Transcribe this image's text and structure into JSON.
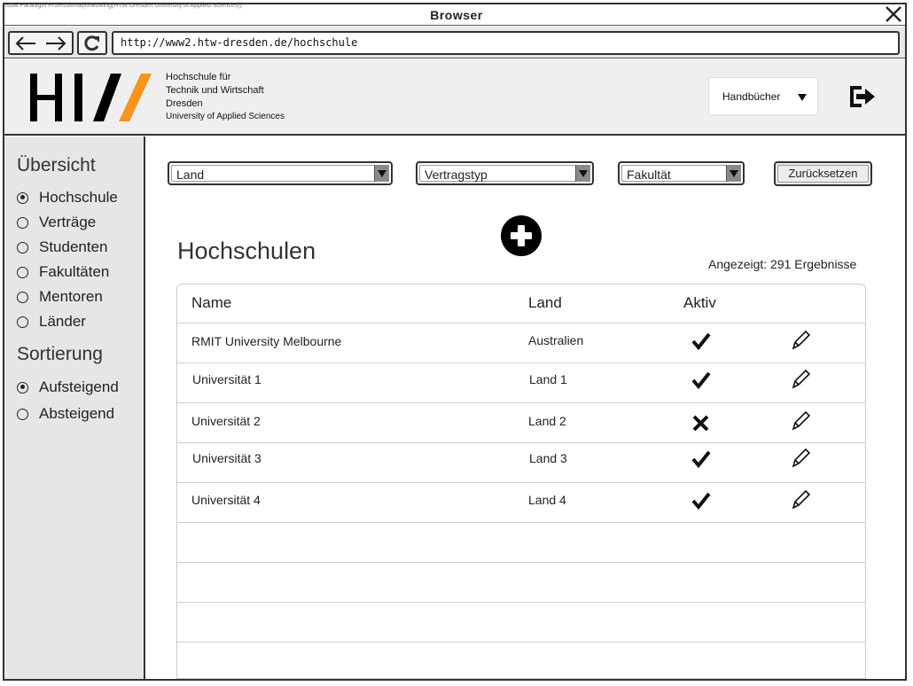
{
  "watermark": "isual Paradigm Professional(khwowing(HTW Dresden University of Applied Sciences))",
  "window": {
    "title": "Browser"
  },
  "browser": {
    "url": "http://www2.htw-dresden.de/hochschule"
  },
  "header": {
    "org_lines": [
      "Hochschule für",
      "Technik und Wirtschaft",
      "Dresden",
      "University of Applied Sciences"
    ],
    "manuals_label": "Handbücher"
  },
  "sidebar": {
    "overview_heading": "Übersicht",
    "overview_items": [
      {
        "label": "Hochschule",
        "selected": true
      },
      {
        "label": "Verträge",
        "selected": false
      },
      {
        "label": "Studenten",
        "selected": false
      },
      {
        "label": "Fakultäten",
        "selected": false
      },
      {
        "label": "Mentoren",
        "selected": false
      },
      {
        "label": "Länder",
        "selected": false
      }
    ],
    "sort_heading": "Sortierung",
    "sort_items": [
      {
        "label": "Aufsteigend",
        "selected": true
      },
      {
        "label": "Absteigend",
        "selected": false
      }
    ]
  },
  "filters": {
    "country": "Land",
    "contract_type": "Vertragstyp",
    "faculty": "Fakultät",
    "reset_label": "Zurücksetzen"
  },
  "main": {
    "title": "Hochschulen",
    "count_text": "Angezeigt: 291 Ergebnisse"
  },
  "table": {
    "columns": [
      "Name",
      "Land",
      "Aktiv"
    ],
    "rows": [
      {
        "name": "RMIT University Melbourne",
        "country": "Australien",
        "active": true
      },
      {
        "name": "Universität 1",
        "country": "Land 1",
        "active": true
      },
      {
        "name": "Universität 2",
        "country": "Land 2",
        "active": false
      },
      {
        "name": "Universität 3",
        "country": "Land 3",
        "active": true
      },
      {
        "name": "Universität 4",
        "country": "Land 4",
        "active": true
      }
    ]
  },
  "icons": {
    "close": "close-icon",
    "back": "arrow-left-icon",
    "forward": "arrow-right-icon",
    "reload": "reload-icon",
    "dropdown": "triangle-down-icon",
    "logout": "logout-icon",
    "add": "plus-circle-icon",
    "check": "checkmark-icon",
    "cross": "cross-icon",
    "edit": "pencil-icon"
  }
}
